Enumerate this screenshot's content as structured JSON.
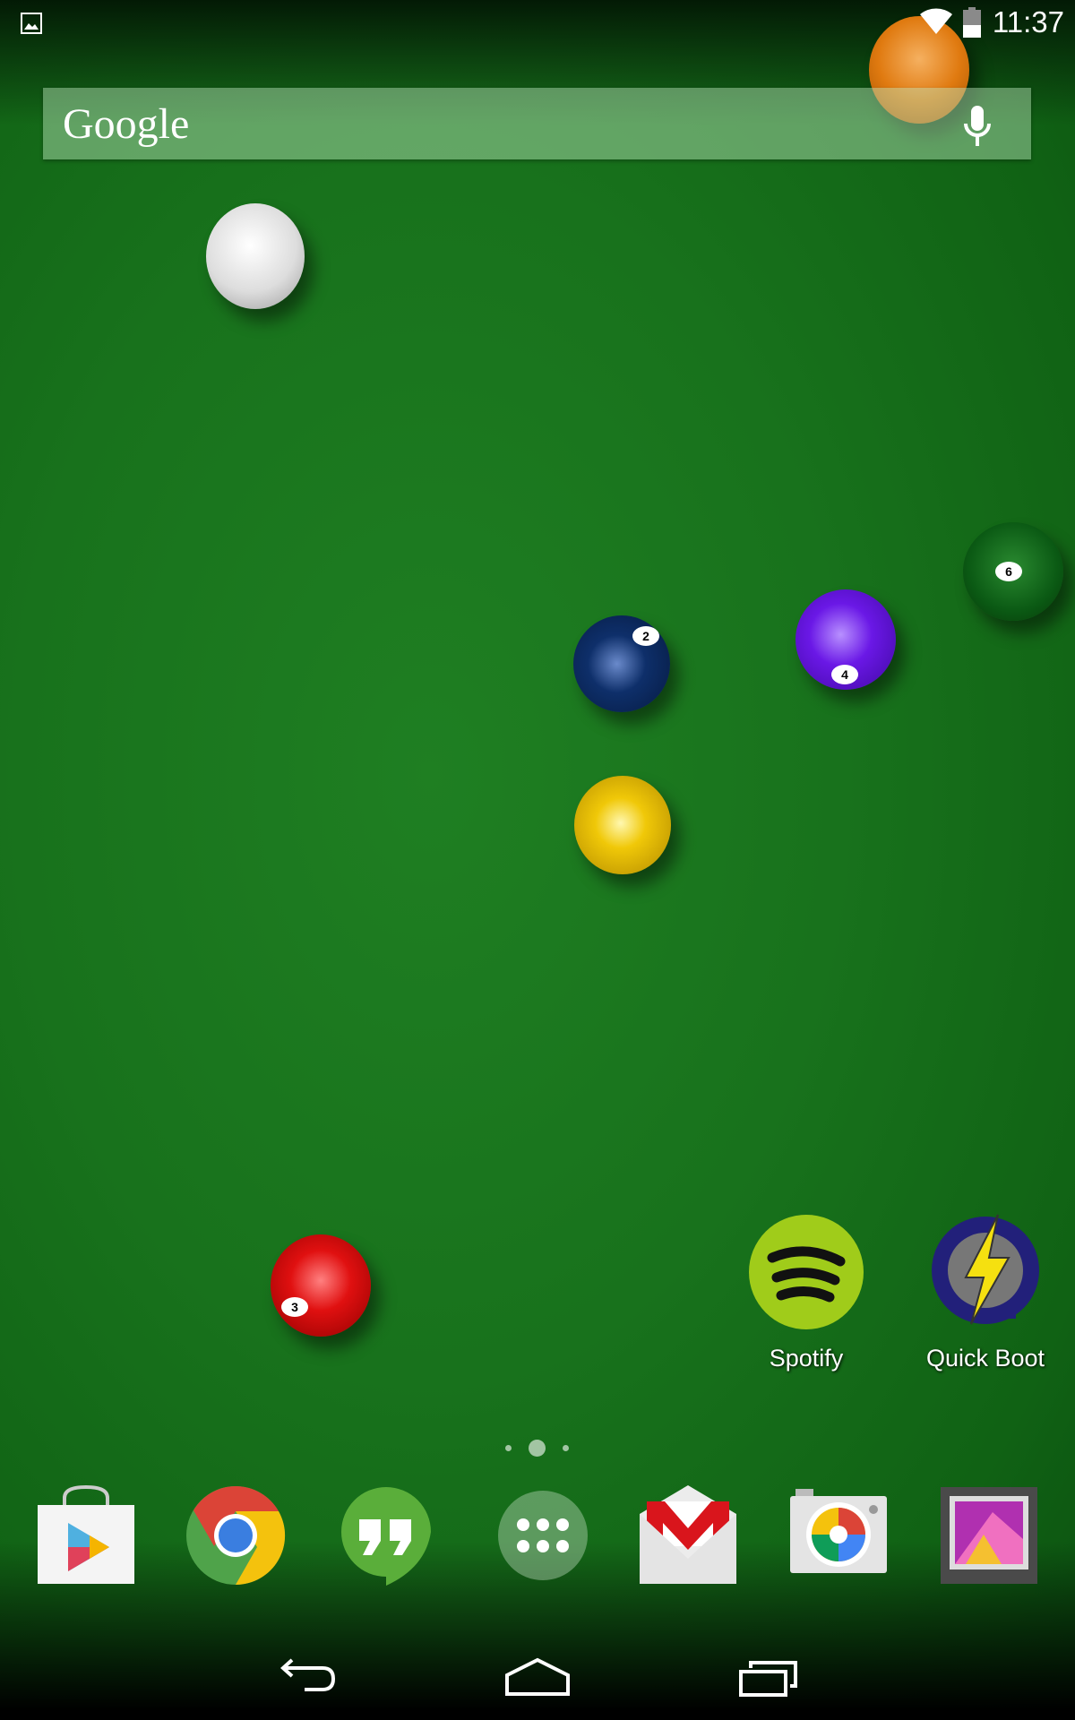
{
  "status_bar": {
    "time": "11:37",
    "notification_icon": "image-icon",
    "wifi_icon": "wifi-icon",
    "battery_icon": "battery-icon",
    "battery_level": 0.4
  },
  "search": {
    "logo": "Google",
    "mic_icon": "microphone-icon"
  },
  "wallpaper": {
    "balls": [
      {
        "name": "cue-ball",
        "color": "#f0f0f0",
        "number": ""
      },
      {
        "name": "orange-ball",
        "color": "#e07a10",
        "number": ""
      },
      {
        "name": "green-6-ball",
        "color": "#0b5a14",
        "number": "6"
      },
      {
        "name": "navy-2-ball",
        "color": "#0e2f6a",
        "number": "2"
      },
      {
        "name": "purple-4-ball",
        "color": "#6a18e6",
        "number": "4"
      },
      {
        "name": "yellow-ball",
        "color": "#f0c808",
        "number": ""
      },
      {
        "name": "red-3-ball",
        "color": "#e01010",
        "number": "3"
      }
    ]
  },
  "home_apps": [
    {
      "label": "Spotify",
      "icon": "spotify-icon"
    },
    {
      "label": "Quick Boot",
      "icon": "quick-boot-icon"
    }
  ],
  "page_indicator": {
    "pages": 3,
    "current": 2
  },
  "dock": [
    {
      "name": "play-store",
      "icon": "play-store-icon"
    },
    {
      "name": "chrome",
      "icon": "chrome-icon"
    },
    {
      "name": "hangouts",
      "icon": "hangouts-icon"
    },
    {
      "name": "app-drawer",
      "icon": "apps-grid-icon"
    },
    {
      "name": "gmail",
      "icon": "gmail-icon"
    },
    {
      "name": "camera",
      "icon": "camera-icon"
    },
    {
      "name": "gallery",
      "icon": "gallery-icon"
    }
  ],
  "nav": {
    "back": "back-icon",
    "home": "home-icon",
    "recents": "recents-icon"
  }
}
